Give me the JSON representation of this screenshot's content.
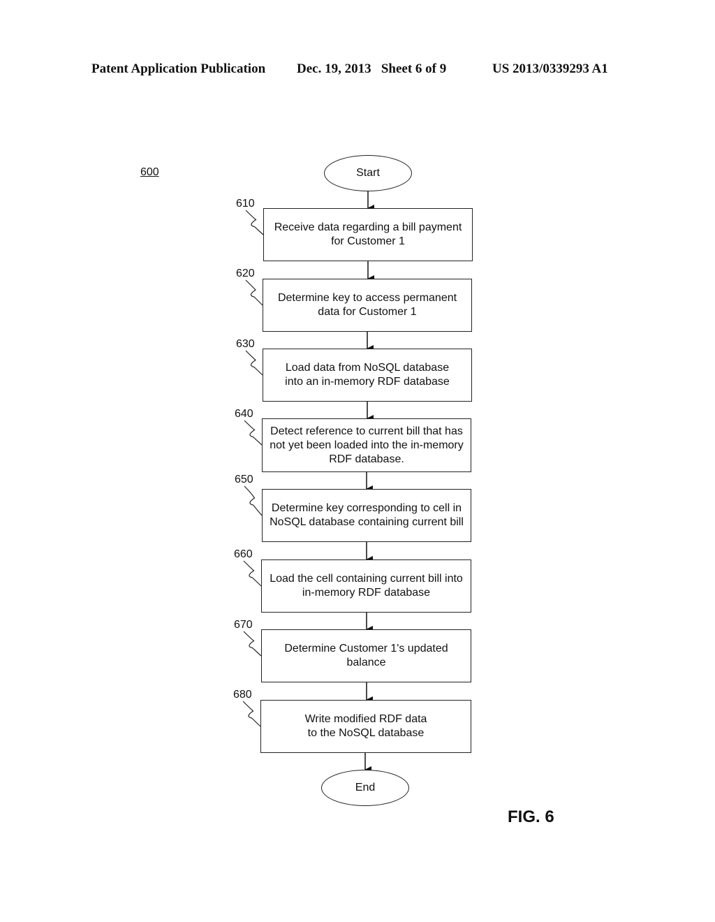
{
  "header": {
    "publication": "Patent Application Publication",
    "date_sheet": "Dec. 19, 2013   Sheet 6 of 9",
    "number": "US 2013/0339293 A1"
  },
  "figure": {
    "id": "600",
    "label": "FIG. 6",
    "start": "Start",
    "end": "End",
    "steps": [
      {
        "ref": "610",
        "lines": [
          "Receive data regarding a bill payment",
          "for Customer 1"
        ]
      },
      {
        "ref": "620",
        "lines": [
          "Determine key to access permanent",
          "data for Customer 1"
        ]
      },
      {
        "ref": "630",
        "lines": [
          "Load data from NoSQL database",
          "into an in-memory RDF database"
        ]
      },
      {
        "ref": "640",
        "lines": [
          "Detect reference to current bill that has",
          "not yet been loaded into the in-memory",
          "RDF database."
        ]
      },
      {
        "ref": "650",
        "lines": [
          "Determine key corresponding to cell in",
          "NoSQL database containing current bill"
        ]
      },
      {
        "ref": "660",
        "lines": [
          "Load the cell containing current bill into",
          "in-memory RDF database"
        ]
      },
      {
        "ref": "670",
        "lines": [
          "Determine Customer 1's updated",
          "balance"
        ]
      },
      {
        "ref": "680",
        "lines": [
          "Write modified RDF data",
          "to the NoSQL database"
        ]
      }
    ]
  }
}
